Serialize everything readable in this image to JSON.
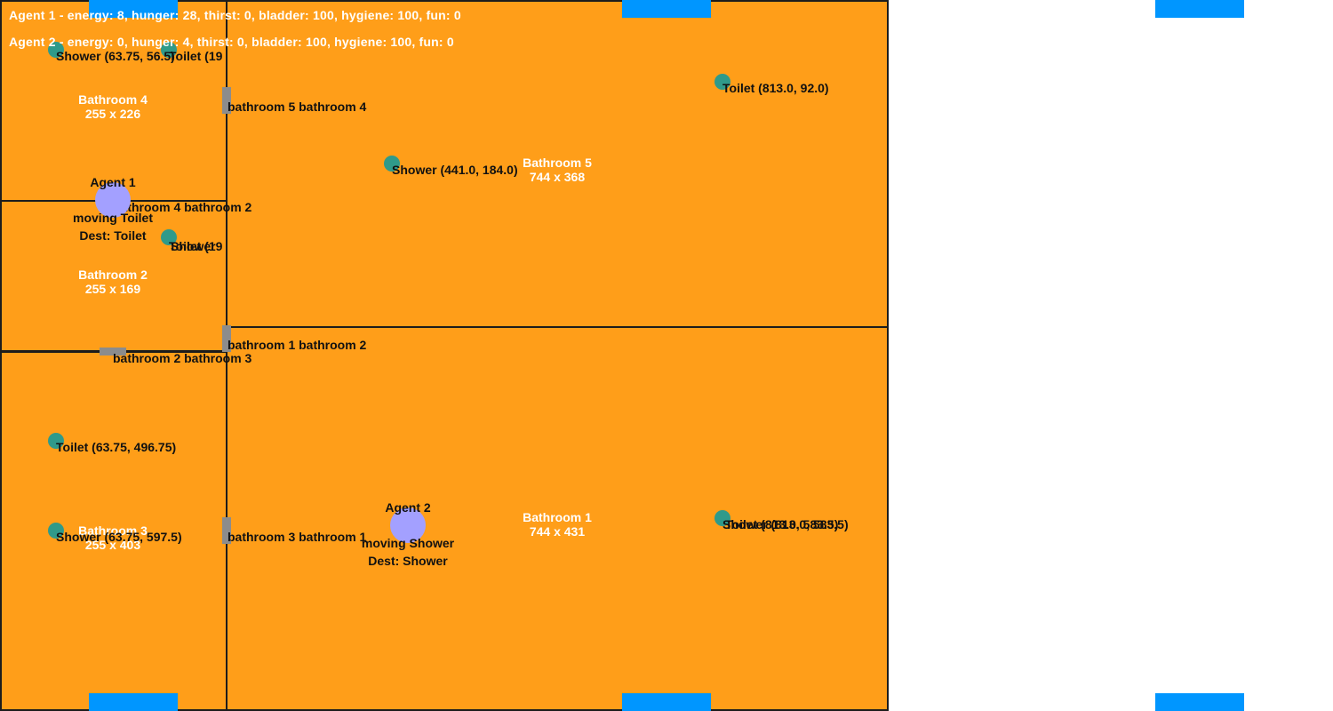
{
  "status": {
    "agent1": "Agent 1 - energy: 8, hunger: 28, thirst: 0, bladder: 100, hygiene: 100, fun: 0",
    "agent2": "Agent 2 - energy: 0, hunger: 4, thirst: 0, bladder: 100, hygiene: 100, fun: 0"
  },
  "rooms": {
    "bathroom4": {
      "name": "Bathroom 4",
      "size": "255 x 226"
    },
    "bathroom2": {
      "name": "Bathroom 2",
      "size": "255 x 169"
    },
    "bathroom3": {
      "name": "Bathroom 3",
      "size": "255 x 403"
    },
    "bathroom5": {
      "name": "Bathroom 5",
      "size": "744 x 368"
    },
    "bathroom1": {
      "name": "Bathroom 1",
      "size": "744 x 431"
    }
  },
  "doors": {
    "d54": "bathroom 5 bathroom 4",
    "d42": "bathroom 4 bathroom 2",
    "d12": "bathroom 1 bathroom 2",
    "d23": "bathroom 2 bathroom 3",
    "d31": "bathroom 3 bathroom 1"
  },
  "objects": {
    "shower_b4": "Shower (63.75, 56.5)",
    "toilet_b4": "Toilet (19",
    "shower_b5": "Shower (441.0, 184.0)",
    "toilet_b5": "Toilet (813.0, 92.0)",
    "toilet_b2": "Toilet (19",
    "shower_b2": "Shower",
    "toilet_b3": "Toilet (63.75, 496.75)",
    "shower_b3": "Shower (63.75, 597.5)",
    "shower_b1": "Shower (813.0, 583.5)",
    "toilet_b1": "Toilet (813.0, 583.5)"
  },
  "agents": {
    "agent1": {
      "name": "Agent 1",
      "state": "moving Toilet",
      "dest": "Dest: Toilet"
    },
    "agent2": {
      "name": "Agent 2",
      "state": "moving Shower",
      "dest": "Dest: Shower"
    }
  },
  "colors": {
    "room_fill": "#ff9e19",
    "object": "#2f9a8a",
    "agent": "#a3a0ff",
    "window": "#0096ff",
    "door": "#8c8c8c"
  }
}
